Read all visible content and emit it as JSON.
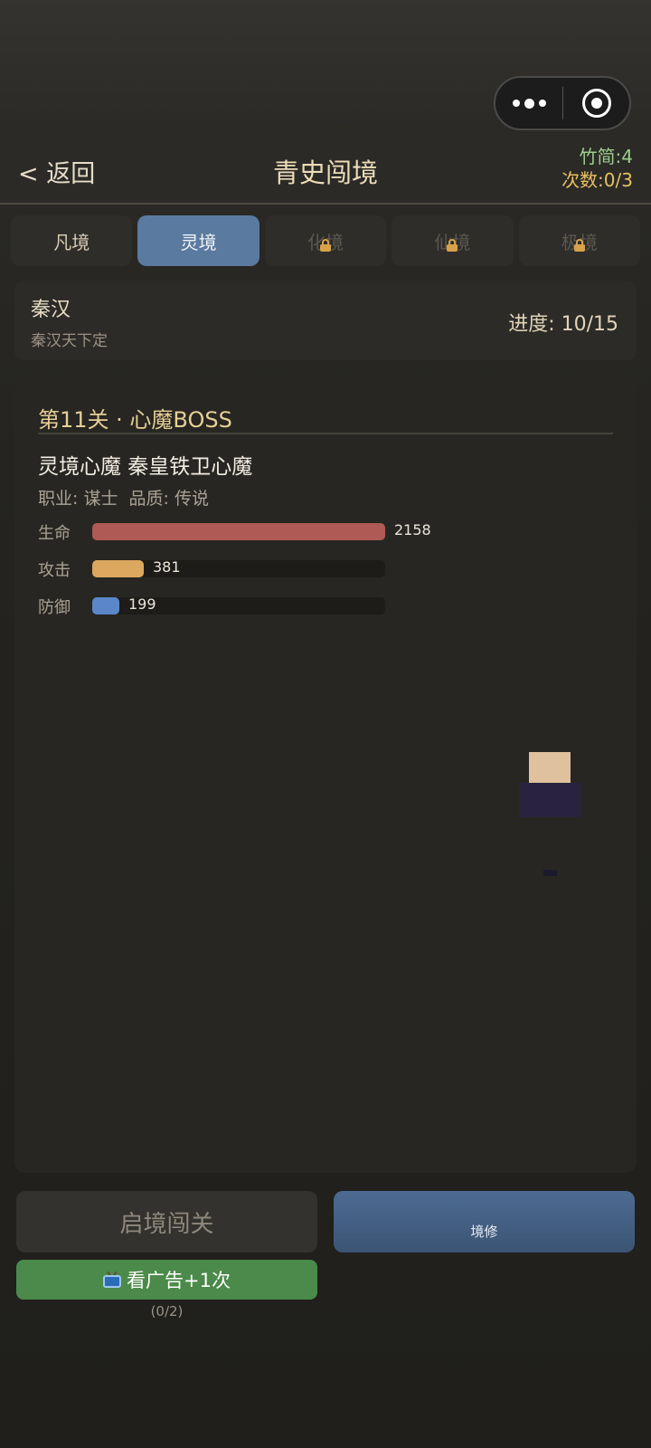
{
  "capsule": {
    "more_icon": "more-dots-icon",
    "close_icon": "target-circle-icon"
  },
  "header": {
    "back_label": "< 返回",
    "title": "青史闯境",
    "bamboo": "竹简:4",
    "attempts": "次数:0/3"
  },
  "tabs": [
    {
      "label": "凡境",
      "active": false,
      "locked": false
    },
    {
      "label": "灵境",
      "active": true,
      "locked": false
    },
    {
      "label": "化境",
      "active": false,
      "locked": true
    },
    {
      "label": "仙境",
      "active": false,
      "locked": true
    },
    {
      "label": "极境",
      "active": false,
      "locked": true
    }
  ],
  "chapter": {
    "name": "秦汉",
    "subtitle": "秦汉天下定",
    "progress": "进度: 10/15"
  },
  "stage": {
    "title": "第11关 · 心魔BOSS",
    "boss_name": "灵境心魔 秦皇铁卫心魔",
    "boss_meta": "职业: 谋士  品质: 传说",
    "stats": [
      {
        "label": "生命",
        "value": "2158",
        "fraction": 1.0,
        "color": "#b05a55"
      },
      {
        "label": "攻击",
        "value": "381",
        "fraction": 0.176,
        "color": "#dca75e"
      },
      {
        "label": "防御",
        "value": "199",
        "fraction": 0.092,
        "color": "#5b87c8"
      }
    ]
  },
  "buttons": {
    "start": "启境闯关",
    "jingxiu": "境修",
    "watch_ad": "看广告+1次",
    "ad_count": "(0/2)"
  }
}
